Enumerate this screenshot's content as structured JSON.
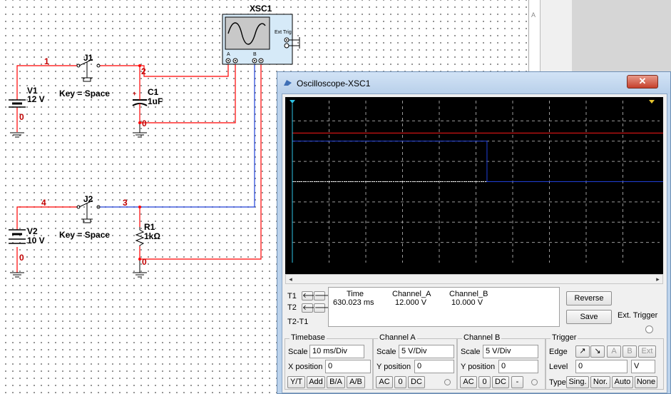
{
  "schematic": {
    "scope": {
      "name": "XSC1",
      "ext_trig_label": "Ext Trig",
      "ch_a": "A",
      "ch_b": "B"
    },
    "source1": {
      "name": "V1",
      "value": "12 V"
    },
    "source2": {
      "name": "V2",
      "value": "10 V"
    },
    "switch1": {
      "name": "J1",
      "key": "Key = Space"
    },
    "switch2": {
      "name": "J2",
      "key": "Key = Space"
    },
    "capacitor": {
      "name": "C1",
      "value": "1uF",
      "polarity": "+"
    },
    "resistor": {
      "name": "R1",
      "value": "1kΩ"
    },
    "nets": {
      "n1": "1",
      "n2": "2",
      "n3": "3",
      "n4": "4",
      "g1": "0",
      "g2": "0",
      "g3": "0",
      "g4": "0"
    },
    "side_letter": "A"
  },
  "window": {
    "title": "Oscilloscope-XSC1",
    "close": "✕"
  },
  "colors": {
    "channel_a": "#ff1a1a",
    "channel_b": "#1f3fd8",
    "screen": "#000000",
    "wire_red": "#ff0000",
    "wire_blue": "#1f3fd8"
  },
  "readout": {
    "t1": "T1",
    "t2": "T2",
    "t2t1": "T2-T1",
    "col_time": "Time",
    "col_a": "Channel_A",
    "col_b": "Channel_B",
    "time": "630.023 ms",
    "val_a": "12.000 V",
    "val_b": "10.000 V"
  },
  "buttons": {
    "reverse": "Reverse",
    "save": "Save",
    "ext_trigger": "Ext. Trigger"
  },
  "timebase": {
    "title": "Timebase",
    "scale_label": "Scale",
    "scale": "10 ms/Div",
    "xpos_label": "X position",
    "xpos": "0",
    "modes": [
      "Y/T",
      "Add",
      "B/A",
      "A/B"
    ]
  },
  "channel_a": {
    "title": "Channel A",
    "scale_label": "Scale",
    "scale": "5  V/Div",
    "ypos_label": "Y position",
    "ypos": "0",
    "coupling": [
      "AC",
      "0",
      "DC"
    ]
  },
  "channel_b": {
    "title": "Channel B",
    "scale_label": "Scale",
    "scale": "5  V/Div",
    "ypos_label": "Y position",
    "ypos": "0",
    "coupling": [
      "AC",
      "0",
      "DC",
      "-"
    ]
  },
  "trigger": {
    "title": "Trigger",
    "edge_label": "Edge",
    "level_label": "Level",
    "level": "0",
    "level_unit": "V",
    "type_label": "Type",
    "sources": [
      "A",
      "B",
      "Ext"
    ],
    "types": [
      "Sing.",
      "Nor.",
      "Auto",
      "None"
    ]
  },
  "traces": {
    "time_div_ms": 10,
    "volts_div": 5,
    "channel_a": {
      "level_v": 12,
      "ends_at_ms": 114
    },
    "channel_b": {
      "level_v": 10,
      "drops_at_ms": 53,
      "after_v": 0,
      "ends_at_ms": 114
    }
  }
}
